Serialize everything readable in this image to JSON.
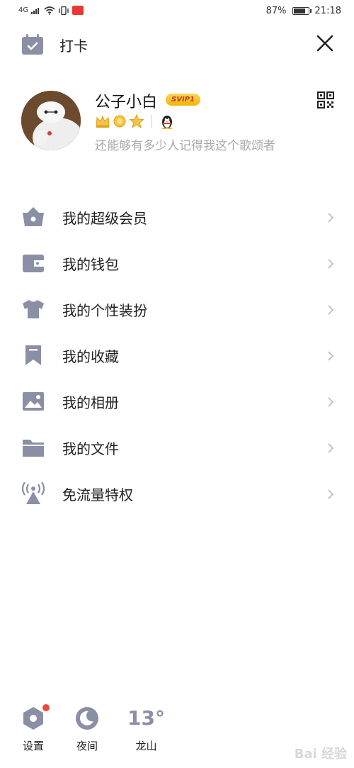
{
  "status_bar": {
    "network": "4G",
    "battery": "87%",
    "battery_level": 0.87,
    "time": "21:18"
  },
  "header": {
    "checkin_label": "打卡"
  },
  "profile": {
    "nickname": "公子小白",
    "vip_badge": "SVIP1",
    "signature": "还能够有多少人记得我这个歌颂者"
  },
  "menu": [
    {
      "label": "我的超级会员",
      "icon": "svip-basket-icon"
    },
    {
      "label": "我的钱包",
      "icon": "wallet-icon"
    },
    {
      "label": "我的个性装扮",
      "icon": "tshirt-icon"
    },
    {
      "label": "我的收藏",
      "icon": "bookmark-icon"
    },
    {
      "label": "我的相册",
      "icon": "photo-icon"
    },
    {
      "label": "我的文件",
      "icon": "folder-icon"
    },
    {
      "label": "免流量特权",
      "icon": "signal-tower-icon"
    }
  ],
  "bottom_bar": {
    "settings_label": "设置",
    "night_label": "夜间",
    "temperature": "13°",
    "city": "龙山"
  },
  "watermark": "Bai 经验",
  "colors": {
    "icon_gray": "#8a8fa6",
    "signature_gray": "#a8a8b0",
    "vip_gold": "#f4b400",
    "notification_red": "#f04a3c"
  }
}
